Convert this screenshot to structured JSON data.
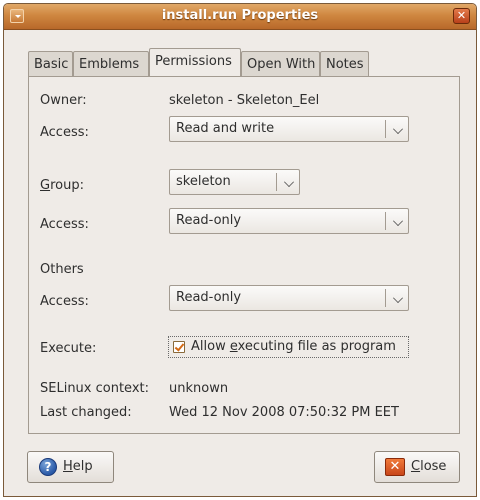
{
  "window": {
    "title": "install.run Properties"
  },
  "tabs": [
    {
      "label": "Basic"
    },
    {
      "label": "Emblems"
    },
    {
      "label": "Permissions"
    },
    {
      "label": "Open With"
    },
    {
      "label": "Notes"
    }
  ],
  "permissions": {
    "owner_label": "Owner:",
    "owner_value": "skeleton - Skeleton_Eel",
    "access_label": "Access:",
    "owner_access": "Read and write",
    "group_label_pre": "",
    "group_label_mnemonic": "G",
    "group_label_rest": "roup:",
    "group_value": "skeleton",
    "group_access": "Read-only",
    "others_heading": "Others",
    "others_access": "Read-only",
    "execute_label": "Execute:",
    "execute_checkbox_pre": "Allow ",
    "execute_checkbox_mnemonic": "e",
    "execute_checkbox_rest": "xecuting file as program",
    "execute_checked": true,
    "selinux_label": "SELinux context:",
    "selinux_value": "unknown",
    "last_changed_label": "Last changed:",
    "last_changed_value": "Wed 12 Nov 2008 07:50:32 PM EET"
  },
  "buttons": {
    "help_mnemonic": "H",
    "help_rest": "elp",
    "close_mnemonic": "C",
    "close_rest": "lose"
  },
  "icons": {
    "window_menu": "window-menu-icon",
    "window_close": "window-close-icon",
    "help": "help-icon",
    "close": "close-icon"
  }
}
